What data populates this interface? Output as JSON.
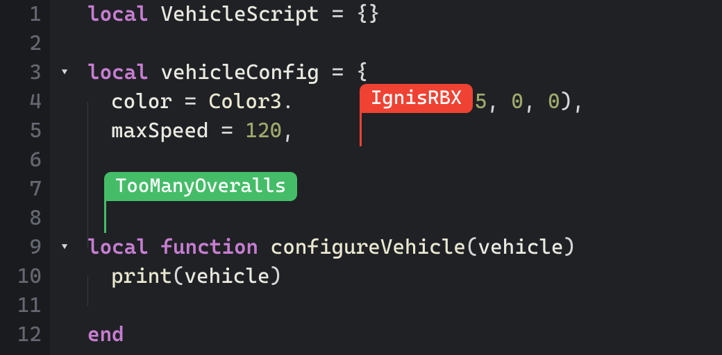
{
  "lines": {
    "n1": "1",
    "n2": "2",
    "n3": "3",
    "n4": "4",
    "n5": "5",
    "n6": "6",
    "n7": "7",
    "n8": "8",
    "n9": "9",
    "n10": "10",
    "n11": "11",
    "n12": "12"
  },
  "fold": {
    "down1": "▾",
    "down2": "▾"
  },
  "code": {
    "l1": {
      "kw": "local",
      "sp": " ",
      "id": "VehicleScript",
      "sp2": " ",
      "eq": "=",
      "sp3": " ",
      "br1": "{",
      "br2": "}"
    },
    "l3": {
      "kw": "local",
      "sp": " ",
      "id": "vehicleConfig",
      "sp2": " ",
      "eq": "=",
      "sp3": " ",
      "br1": "{"
    },
    "l4": {
      "indent": "    ",
      "id": "color",
      "sp": " ",
      "eq": "=",
      "sp2": " ",
      "fn": "Color3",
      "dot": ".",
      "tail": "5",
      "c1": ",",
      "sp3": " ",
      "v2": "0",
      "c2": ",",
      "sp4": " ",
      "v3": "0",
      "close": ")",
      "c3": ","
    },
    "l5": {
      "indent": "    ",
      "id": "maxSpeed",
      "sp": " ",
      "eq": "=",
      "sp2": " ",
      "num": "120",
      "comma": ","
    },
    "l9": {
      "kw1": "local",
      "sp": " ",
      "kw2": "function",
      "sp2": " ",
      "fn": "configureVehicle",
      "open": "(",
      "arg": "vehicle",
      "close": ")"
    },
    "l10": {
      "indent": "    ",
      "fn": "print",
      "open": "(",
      "arg": "vehicle",
      "close": ")"
    },
    "l12": {
      "kw": "end"
    }
  },
  "collab": {
    "user1": "IgnisRBX",
    "user2": "TooManyOveralls"
  },
  "colors": {
    "red": "#ef4233",
    "green": "#45bd68"
  }
}
